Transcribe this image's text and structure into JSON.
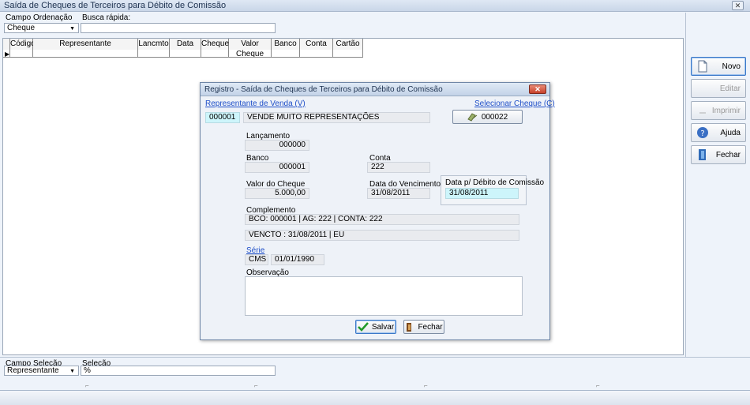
{
  "window": {
    "title": "Saída de Cheques de Terceiros para Débito de Comissão",
    "close_glyph": "✕"
  },
  "top": {
    "sort_label": "Campo Ordenação",
    "sort_value": "Cheque",
    "search_label": "Busca rápida:",
    "search_value": ""
  },
  "grid": {
    "columns": [
      "Código",
      "Representante",
      "Lancmto",
      "Data",
      "Cheque",
      "Valor Cheque",
      "Banco",
      "Conta",
      "Cartão"
    ]
  },
  "sidebar": {
    "novo": "Novo",
    "editar": "Editar",
    "imprimir": "Imprimir",
    "ajuda": "Ajuda",
    "fechar": "Fechar"
  },
  "bottom": {
    "campo_label": "Campo Seleção",
    "campo_value": "Representante",
    "selecao_label": "Seleção",
    "selecao_value": "%"
  },
  "dialog": {
    "title": "Registro - Saída de Cheques de Terceiros para Débito de Comissão",
    "rep_link": "Representante de Venda (V)",
    "rep_code": "000001",
    "rep_name": "VENDE MUITO REPRESENTAÇÕES",
    "sel_cheque_link": "Selecionar Cheque (C)",
    "cheque_num": "000022",
    "lanc_label": "Lançamento",
    "lanc_value": "000000",
    "banco_label": "Banco",
    "banco_value": "000001",
    "conta_label": "Conta",
    "conta_value": "222",
    "valor_label": "Valor do Cheque",
    "valor_value": "5.000,00",
    "venc_label": "Data do Vencimento",
    "venc_value": "31/08/2011",
    "debito_label": "Data p/ Débito de Comissão",
    "debito_value": "31/08/2011",
    "compl_label": "Complemento",
    "compl_line1": "BCO: 000001 | AG: 222 | CONTA: 222",
    "compl_line2": "VENCTO : 31/08/2011 | EU",
    "serie_link": "Série",
    "serie_code": "CMS",
    "serie_date": "01/01/1990",
    "obs_label": "Observação",
    "salvar": "Salvar",
    "fechar": "Fechar"
  }
}
